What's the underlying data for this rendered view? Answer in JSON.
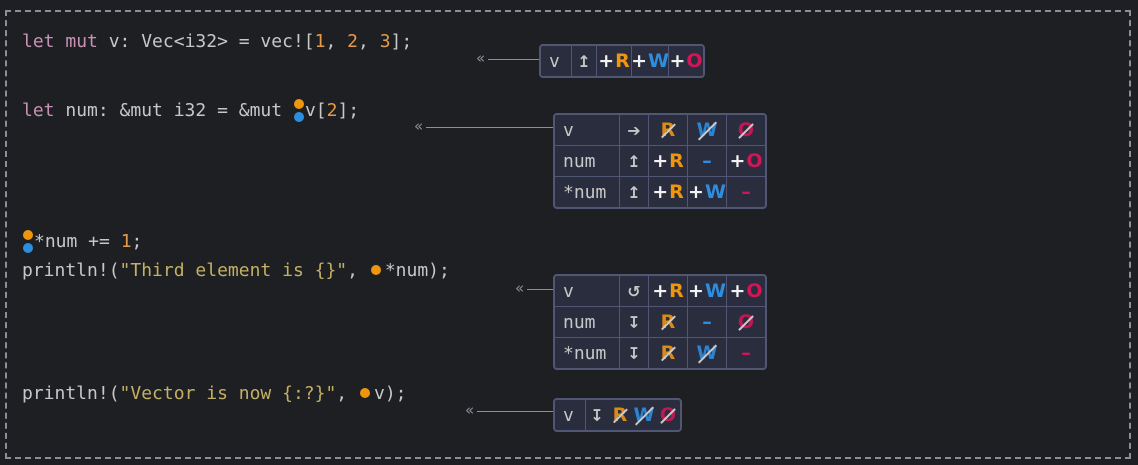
{
  "lines": [
    {
      "kw1": "let",
      "kw2": "mut",
      "rest": " v: Vec<i32> = vec![",
      "n1": "1",
      "c1": ", ",
      "n2": "2",
      "c2": ", ",
      "n3": "3",
      "end": "];"
    },
    {
      "kw1": "let",
      "rest": " num: &mut i32 = &mut ",
      "tail": "v[",
      "n": "2",
      "end": "];"
    },
    {
      "prefix": "*num += ",
      "n": "1",
      "end": ";"
    },
    {
      "fn": "println!(",
      "str": "\"Third element is {}\"",
      "mid": ", ",
      "tail": "*num);"
    },
    {
      "fn": "println!(",
      "str": "\"Vector is now {:?}\"",
      "mid": ", ",
      "tail": "v);"
    }
  ],
  "perm_tables": [
    {
      "rows": [
        {
          "var": "v",
          "arrow": "↥",
          "R": "R",
          "W": "W",
          "O": "O"
        }
      ]
    },
    {
      "rows": [
        {
          "var": "v",
          "arrow": "➔",
          "R": "R",
          "W": "W",
          "O": "O"
        },
        {
          "var": "num",
          "arrow": "↥",
          "R": "R",
          "W": "–",
          "O": "O"
        },
        {
          "var": "*num",
          "arrow": "↥",
          "R": "R",
          "W": "W",
          "O": "–"
        }
      ]
    },
    {
      "rows": [
        {
          "var": "v",
          "arrow": "↺",
          "R": "R",
          "W": "W",
          "O": "O"
        },
        {
          "var": "num",
          "arrow": "↧",
          "R": "R",
          "W": "–",
          "O": "O"
        },
        {
          "var": "*num",
          "arrow": "↧",
          "R": "R",
          "W": "W",
          "O": "–"
        }
      ]
    },
    {
      "rows": [
        {
          "var": "v",
          "arrow": "↧",
          "R": "R",
          "W": "W",
          "O": "O"
        }
      ]
    }
  ],
  "symbols": {
    "plus": "+",
    "lead": "«"
  },
  "colors": {
    "read": "#f0960e",
    "write": "#2d8ee0",
    "own": "#d11656",
    "keyword": "#c792b5",
    "number": "#e69a4a",
    "string": "#c3b066"
  }
}
